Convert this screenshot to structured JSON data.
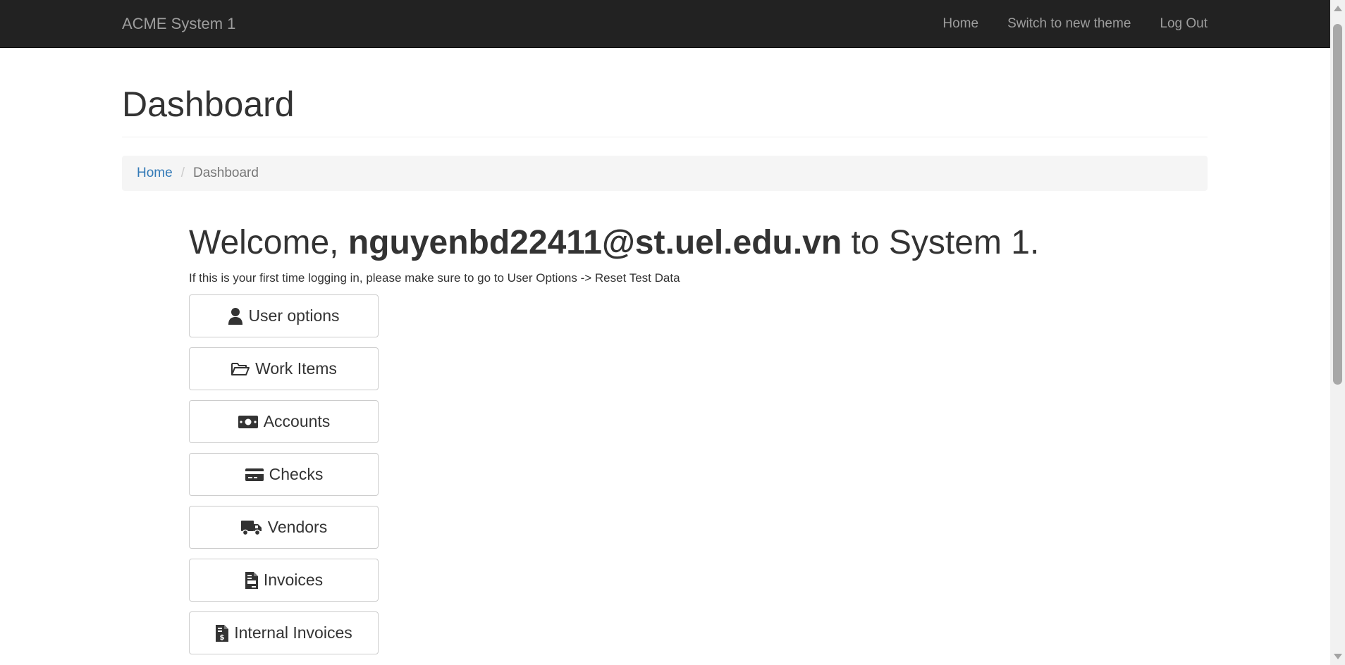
{
  "navbar": {
    "brand": "ACME System 1",
    "links": [
      "Home",
      "Switch to new theme",
      "Log Out"
    ]
  },
  "page": {
    "title": "Dashboard"
  },
  "breadcrumb": {
    "home": "Home",
    "separator": "/",
    "current": "Dashboard"
  },
  "welcome": {
    "prefix": "Welcome,",
    "user": "nguyenbd22411@st.uel.edu.vn",
    "suffix": "to System 1.",
    "notice": "If this is your first time logging in, please make sure to go to User Options -> Reset Test Data"
  },
  "menu": [
    {
      "label": "User options",
      "icon": "user-icon"
    },
    {
      "label": "Work Items",
      "icon": "folder-open-icon"
    },
    {
      "label": "Accounts",
      "icon": "money-bill-icon"
    },
    {
      "label": "Checks",
      "icon": "credit-card-icon"
    },
    {
      "label": "Vendors",
      "icon": "truck-icon"
    },
    {
      "label": "Invoices",
      "icon": "file-invoice-icon"
    },
    {
      "label": "Internal Invoices",
      "icon": "file-invoice-dollar-icon"
    }
  ],
  "colors": {
    "navbar_bg": "#222222",
    "navbar_text": "#9d9d9d",
    "link": "#337ab7",
    "text": "#333333"
  }
}
